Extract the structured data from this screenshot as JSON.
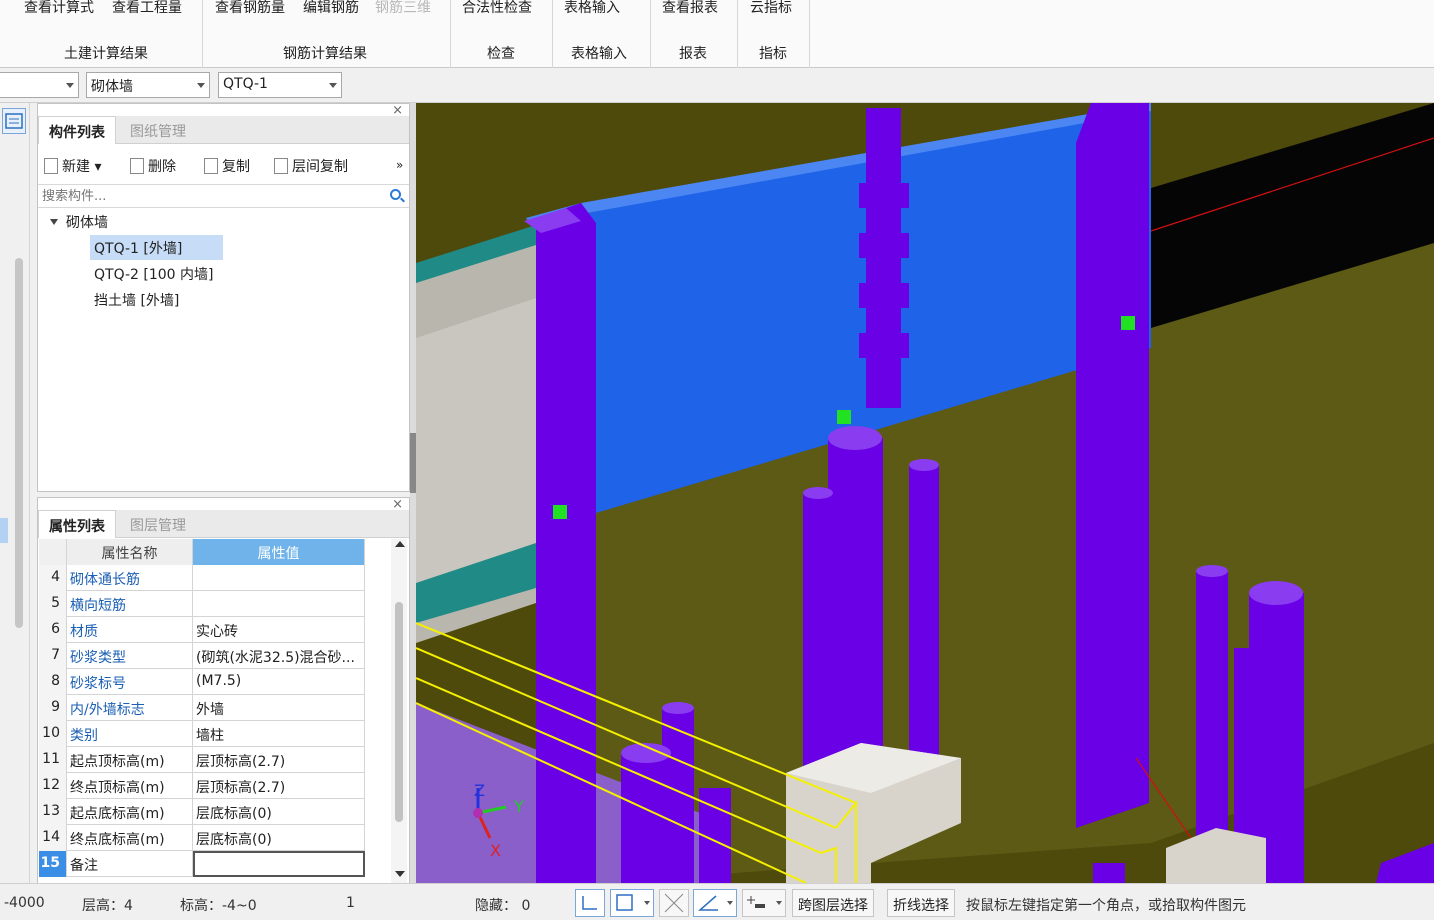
{
  "ribbon": {
    "groups": [
      {
        "label": "土建计算结果",
        "buttons": [
          "查看计算式",
          "查看工程量"
        ]
      },
      {
        "label": "钢筋计算结果",
        "buttons": [
          "查看钢筋量",
          "编辑钢筋",
          "钢筋三维"
        ]
      },
      {
        "label": "检查",
        "buttons": [
          "合法性检查"
        ]
      },
      {
        "label": "表格输入",
        "buttons": [
          "表格输入"
        ]
      },
      {
        "label": "报表",
        "buttons": [
          "查看报表"
        ]
      },
      {
        "label": "指标",
        "buttons": [
          "云指标"
        ]
      }
    ]
  },
  "selectors": {
    "type_value": "砌体墙",
    "component_value": "QTQ-1"
  },
  "component_panel": {
    "tabs": [
      "构件列表",
      "图纸管理"
    ],
    "toolbar": {
      "new": "新建",
      "delete": "删除",
      "copy": "复制",
      "floor_copy": "层间复制",
      "more": "»"
    },
    "search_placeholder": "搜索构件...",
    "tree_root": "砌体墙",
    "items": [
      "QTQ-1 [外墙]",
      "QTQ-2 [100 内墙]",
      "挡土墙 [外墙]"
    ],
    "close": "×"
  },
  "property_panel": {
    "tabs": [
      "属性列表",
      "图层管理"
    ],
    "close": "×",
    "header": {
      "name": "属性名称",
      "value": "属性值"
    },
    "rows": [
      {
        "num": "4",
        "name": "砌体通长筋",
        "value": ""
      },
      {
        "num": "5",
        "name": "横向短筋",
        "value": ""
      },
      {
        "num": "6",
        "name": "材质",
        "value": "实心砖"
      },
      {
        "num": "7",
        "name": "砂浆类型",
        "value": "(砌筑(水泥32.5)混合砂..."
      },
      {
        "num": "8",
        "name": "砂浆标号",
        "value": "(M7.5)"
      },
      {
        "num": "9",
        "name": "内/外墙标志",
        "value": "外墙"
      },
      {
        "num": "10",
        "name": "类别",
        "value": "墙柱"
      },
      {
        "num": "11",
        "name": "起点顶标高(m)",
        "value": "层顶标高(2.7)"
      },
      {
        "num": "12",
        "name": "终点顶标高(m)",
        "value": "层顶标高(2.7)"
      },
      {
        "num": "13",
        "name": "起点底标高(m)",
        "value": "层底标高(0)"
      },
      {
        "num": "14",
        "name": "终点底标高(m)",
        "value": "层底标高(0)"
      },
      {
        "num": "15",
        "name": "备注",
        "value": ""
      }
    ]
  },
  "axis": {
    "x": "X",
    "y": "Y",
    "z": "Z"
  },
  "status": {
    "coord": "-4000",
    "floor_height": "层高：4",
    "elevation": "标高：-4~0",
    "count": "1",
    "hidden": "隐藏： 0",
    "cross_layer": "跨图层选择",
    "polyline": "折线选择",
    "hint": "按鼠标左键指定第一个角点，或拾取构件图元"
  },
  "colors": {
    "wall_olive": "#5c5a14",
    "beam_blue": "#1f63e8",
    "column_purple": "#6a00e6",
    "teal": "#1f8a86",
    "header_blue": "#6fb3ea",
    "selection": "#c6dcf7"
  }
}
